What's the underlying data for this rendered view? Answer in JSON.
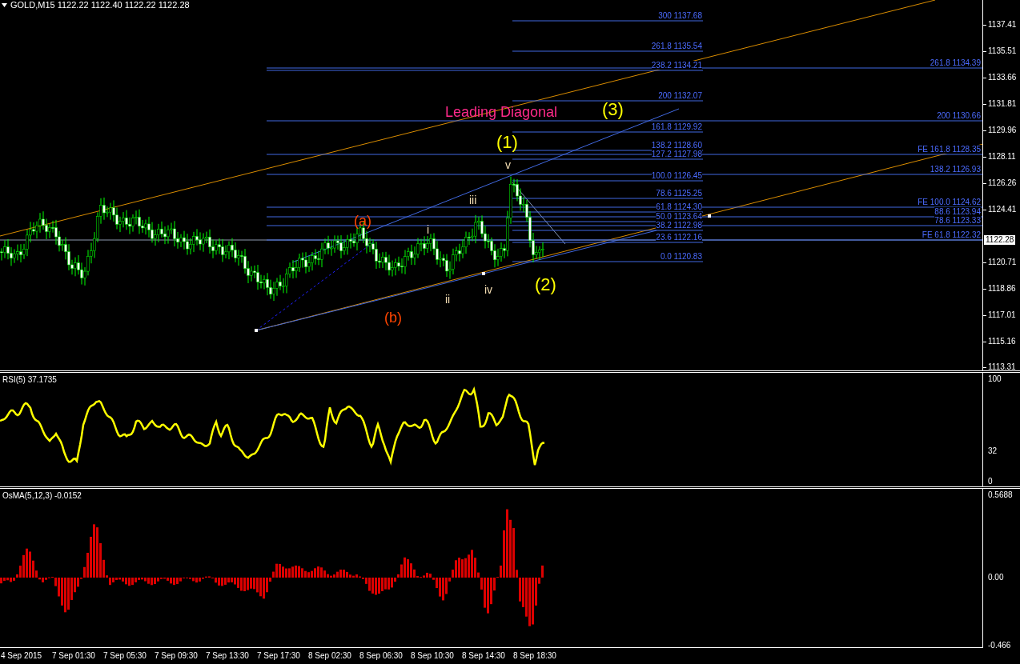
{
  "header": {
    "quote": "GOLD,M15 1122.22 1122.40 1122.22 1122.28"
  },
  "price_chart": {
    "fib_levels": [
      {
        "label": "300 1137.68"
      },
      {
        "label": "261.8 1135.54"
      },
      {
        "label": "238.2 1134.21"
      },
      {
        "label": "200 1132.07"
      },
      {
        "label": "161.8 1129.92"
      },
      {
        "label": "138.2 1128.60"
      },
      {
        "label": "127.2 1127.98"
      },
      {
        "label": "100.0 1126.45"
      },
      {
        "label": "78.6 1125.25"
      },
      {
        "label": "61.8 1124.30"
      },
      {
        "label": "50.0 1123.64"
      },
      {
        "label": "38.2 1122.98"
      },
      {
        "label": "23.6 1122.16"
      },
      {
        "label": "0.0 1120.83"
      }
    ],
    "extension_levels": [
      {
        "label": "261.8 1134.39"
      },
      {
        "label": "200 1130.66"
      },
      {
        "label": "FE 161.8 1128.35"
      },
      {
        "label": "138.2 1126.93"
      },
      {
        "label": "FE 100.0 1124.62"
      },
      {
        "label": "88.6 1123.94"
      },
      {
        "label": "78.6 1123.33"
      },
      {
        "label": "FE 61.8 1122.32"
      }
    ],
    "wave_labels": [
      {
        "text": "Leading Diagonal",
        "color": "#ff2a8a"
      },
      {
        "text": "(3)",
        "color": "#ffff00"
      },
      {
        "text": "(1)",
        "color": "#ffff00"
      },
      {
        "text": "v",
        "color": "#f5deb3"
      },
      {
        "text": "iii",
        "color": "#f5deb3"
      },
      {
        "text": "(a)",
        "color": "#ff4500"
      },
      {
        "text": "i",
        "color": "#f5deb3"
      },
      {
        "text": "ii",
        "color": "#f5deb3"
      },
      {
        "text": "iv",
        "color": "#f5deb3"
      },
      {
        "text": "(b)",
        "color": "#ff4500"
      },
      {
        "text": "(2)",
        "color": "#ffff00"
      }
    ],
    "current_price": "1122.28",
    "price_axis": [
      "1137.41",
      "1135.51",
      "1133.66",
      "1131.81",
      "1129.96",
      "1128.11",
      "1126.26",
      "1124.41",
      "1120.71",
      "1118.86",
      "1117.01",
      "1115.16",
      "1113.31"
    ]
  },
  "rsi_panel": {
    "title": "RSI(5) 37.1735",
    "axis": [
      "100",
      "32",
      "0"
    ]
  },
  "osma_panel": {
    "title": "OsMA(5,12,3) -0.0152",
    "axis": [
      "0.5688",
      "0.00",
      "-0.466"
    ]
  },
  "time_axis": [
    "4 Sep 2015",
    "7 Sep 01:30",
    "7 Sep 05:30",
    "7 Sep 09:30",
    "7 Sep 13:30",
    "7 Sep 17:30",
    "8 Sep 02:30",
    "8 Sep 06:30",
    "8 Sep 10:30",
    "8 Sep 14:30",
    "8 Sep 18:30"
  ]
}
